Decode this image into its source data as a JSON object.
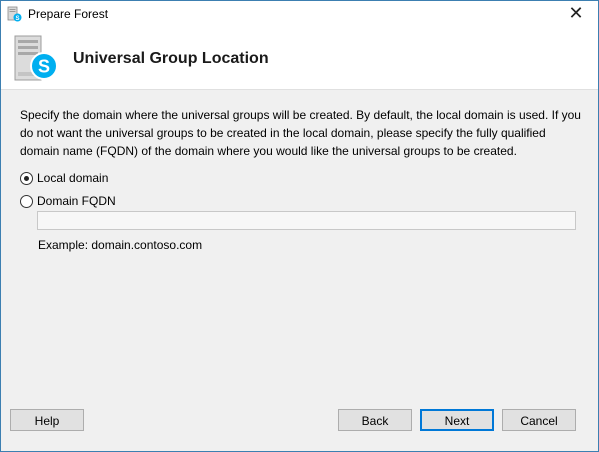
{
  "window": {
    "title": "Prepare Forest",
    "close_glyph": "✕",
    "icon": "app-server-icon"
  },
  "header": {
    "title": "Universal Group Location",
    "graphic": "skype-server-icon"
  },
  "content": {
    "description": "Specify the domain where the universal groups will be created. By default, the local domain is used. If you do not want the universal groups to be created in the local domain, please specify the fully qualified domain name (FQDN) of the domain where you would like the universal groups to be created.",
    "options": [
      {
        "label": "Local domain",
        "selected": true
      },
      {
        "label": "Domain FQDN",
        "selected": false
      }
    ],
    "fqdn_value": "",
    "example": "Example: domain.contoso.com"
  },
  "buttons": {
    "help": "Help",
    "back": "Back",
    "next": "Next",
    "cancel": "Cancel"
  },
  "colors": {
    "accent": "#0078d7",
    "skype_blue": "#00aff0"
  }
}
